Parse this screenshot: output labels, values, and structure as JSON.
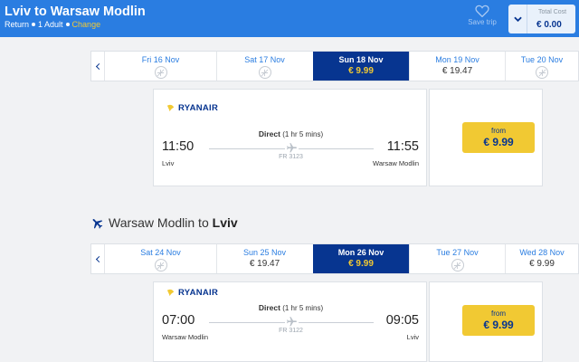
{
  "header": {
    "title": "Lviv to Warsaw Modlin",
    "trip_type": "Return",
    "passengers": "1 Adult",
    "change_label": "Change",
    "save_trip_label": "Save trip",
    "total_cost_label": "Total Cost",
    "total_cost_value": "€ 0.00"
  },
  "outbound": {
    "dates": [
      {
        "label": "Fri 16 Nov",
        "price": null
      },
      {
        "label": "Sat 17 Nov",
        "price": null
      },
      {
        "label": "Sun 18 Nov",
        "price": "€ 9.99",
        "selected": true
      },
      {
        "label": "Mon 19 Nov",
        "price": "€ 19.47"
      },
      {
        "label": "Tue 20 Nov",
        "price": null
      }
    ],
    "flight": {
      "airline": "RYANAIR",
      "type": "Direct",
      "duration": "(1 hr 5 mins)",
      "depart_time": "11:50",
      "arrive_time": "11:55",
      "depart_city": "Lviv",
      "arrive_city": "Warsaw Modlin",
      "flight_number": "FR 3123"
    },
    "price_button": {
      "from_label": "from",
      "price": "€ 9.99"
    }
  },
  "return": {
    "section_prefix": "Warsaw Modlin to ",
    "section_dest": "Lviv",
    "dates": [
      {
        "label": "Sat 24 Nov",
        "price": null
      },
      {
        "label": "Sun 25 Nov",
        "price": "€ 19.47"
      },
      {
        "label": "Mon 26 Nov",
        "price": "€ 9.99",
        "selected": true
      },
      {
        "label": "Tue 27 Nov",
        "price": null
      },
      {
        "label": "Wed 28 Nov",
        "price": "€ 9.99"
      }
    ],
    "flight": {
      "airline": "RYANAIR",
      "type": "Direct",
      "duration": "(1 hr 5 mins)",
      "depart_time": "07:00",
      "arrive_time": "09:05",
      "depart_city": "Warsaw Modlin",
      "arrive_city": "Lviv",
      "flight_number": "FR 3122"
    },
    "price_button": {
      "from_label": "from",
      "price": "€ 9.99"
    }
  },
  "colors": {
    "header_blue": "#2a7de1",
    "navy": "#073590",
    "yellow": "#f1c933"
  },
  "icons": [
    "heart-icon",
    "chevron-down-icon",
    "chevron-left-icon",
    "no-flight-icon",
    "plane-icon",
    "ryanair-harp-icon"
  ]
}
